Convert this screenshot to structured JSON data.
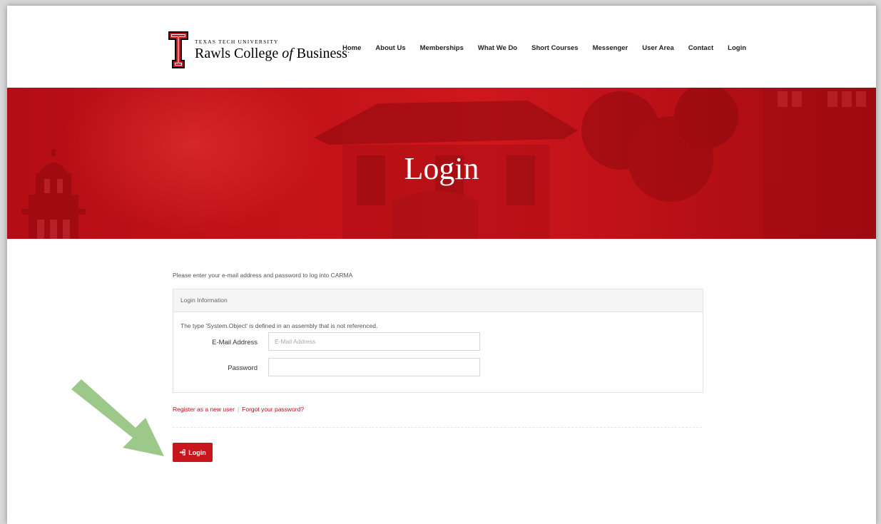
{
  "header": {
    "logo": {
      "top_text": "TEXAS TECH UNIVERSITY",
      "main_prefix": "Rawls College ",
      "main_italic": "of",
      "main_suffix": " Business",
      "trademark": "·"
    },
    "nav": [
      {
        "label": "Home"
      },
      {
        "label": "About Us"
      },
      {
        "label": "Memberships"
      },
      {
        "label": "What We Do"
      },
      {
        "label": "Short Courses"
      },
      {
        "label": "Messenger"
      },
      {
        "label": "User Area"
      },
      {
        "label": "Contact"
      },
      {
        "label": "Login"
      }
    ]
  },
  "hero": {
    "title": "Login"
  },
  "form": {
    "intro": "Please enter your e-mail address and password to log into CARMA",
    "panel_title": "Login Information",
    "error": "The type 'System.Object' is defined in an assembly that is not referenced.",
    "email_label": "E-Mail Address",
    "email_placeholder": "E-Mail Address",
    "email_value": "",
    "password_label": "Password",
    "password_value": "",
    "register_link": "Register as a new user",
    "separator": "|",
    "forgot_link": "Forgot your password?",
    "login_button": "Login"
  },
  "colors": {
    "brand_red": "#c8161d",
    "link_red": "#b0121a",
    "arrow_green": "#9cc98a"
  }
}
